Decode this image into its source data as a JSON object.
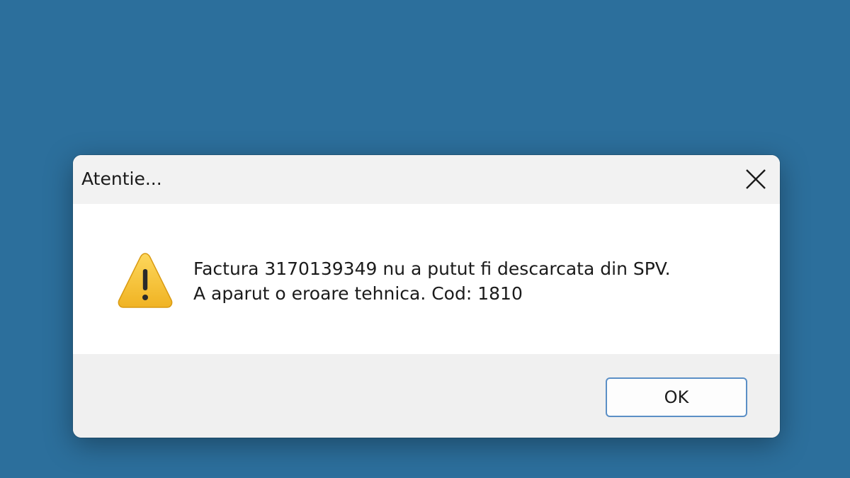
{
  "dialog": {
    "title": "Atentie...",
    "close_icon": "close-icon",
    "warning_icon": "warning-icon",
    "warning_color": "#f7c23c",
    "message_line1": "Factura 3170139349 nu a putut fi descarcata din SPV.",
    "message_line2": "A aparut o eroare tehnica. Cod: 1810",
    "ok_label": "OK"
  },
  "colors": {
    "desktop_background": "#2c6f9c",
    "button_border": "#5b8fc6"
  }
}
